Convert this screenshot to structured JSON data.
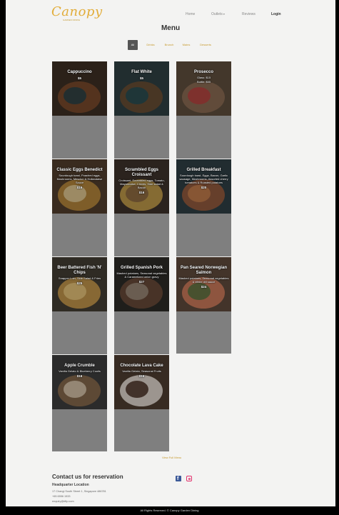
{
  "brand": {
    "logo": "Canopy",
    "tagline": "GARDEN DINING"
  },
  "nav": {
    "home": "Home",
    "outlets": "Outlets",
    "reviews": "Reviews",
    "login": "Login"
  },
  "page_title": "Menu",
  "filters": [
    "All",
    "Drinks",
    "Brunch",
    "Mains",
    "Desserts"
  ],
  "active_filter": "All",
  "menu_items": [
    {
      "title": "Cappuccino",
      "desc": "",
      "price": "$5",
      "image_icon": "coffee-cup-icon"
    },
    {
      "title": "Flat White",
      "desc": "",
      "price": "$5",
      "image_icon": "coffee-cup-icon"
    },
    {
      "title": "Prosecco",
      "desc": "Glass: $15\nBottle: $55",
      "price": "",
      "image_icon": "wine-bottle-icon"
    },
    {
      "title": "Classic Eggs Benedict",
      "desc": "Sourdough toast, Poached eggs, Mushrooms, Mesclun & Hollandaise Sauce",
      "price": "$16",
      "image_icon": "plate-icon"
    },
    {
      "title": "Scrambled Eggs Croissant",
      "desc": "Croissant, Scrambled eggs, Tomato, Mayonnaise, Chives, Side salad & Bacon",
      "price": "$16",
      "image_icon": "plate-icon"
    },
    {
      "title": "Grilled Breakfast",
      "desc": "Sourdough toast, Eggs, Bacon, Garlic sausage, Mushrooms, Assorted cherry tomatoes & Roasted potatoes",
      "price": "$20",
      "image_icon": "plate-icon"
    },
    {
      "title": "Beer Battered Fish 'N' Chips",
      "desc": "Snapper Loin, Side Salad & Fries",
      "price": "$25",
      "image_icon": "plate-icon"
    },
    {
      "title": "Grilled Spanish Pork",
      "desc": "Mashed potatoes, Seasonal vegetables & Caramelized onion gravy",
      "price": "$27",
      "image_icon": "plate-icon"
    },
    {
      "title": "Pan Seared Norwegian Salmon",
      "desc": "Mashed potatoes, Seasonal vegetables & White dill sauce",
      "price": "$24",
      "image_icon": "plate-icon"
    },
    {
      "title": "Apple Crumble",
      "desc": "Vanilla Gelato & Blueberry Coulis",
      "price": "$16",
      "image_icon": "dessert-icon"
    },
    {
      "title": "Chocolate Lava Cake",
      "desc": "Vanilla Gelato, Seasonal Fruits",
      "price": "$16",
      "image_icon": "dessert-icon"
    }
  ],
  "view_full_menu": "View Full Menu",
  "contact": {
    "title": "Contact us for reservation",
    "hq_label": "Headquarter Location",
    "address": "17 Changi South Street 1, Singapore 486781",
    "phone": "+65 6556 1533",
    "email": "enquiry@dltp.com"
  },
  "social": [
    "facebook-icon",
    "instagram-icon"
  ],
  "footer": "All Rights Reserved. © Canopy Garden Dining",
  "colors": {
    "accent": "#c79a2e",
    "logo": "#e2ad3a",
    "card_bg": "#7f7f7f",
    "active_filter_bg": "#555555"
  }
}
